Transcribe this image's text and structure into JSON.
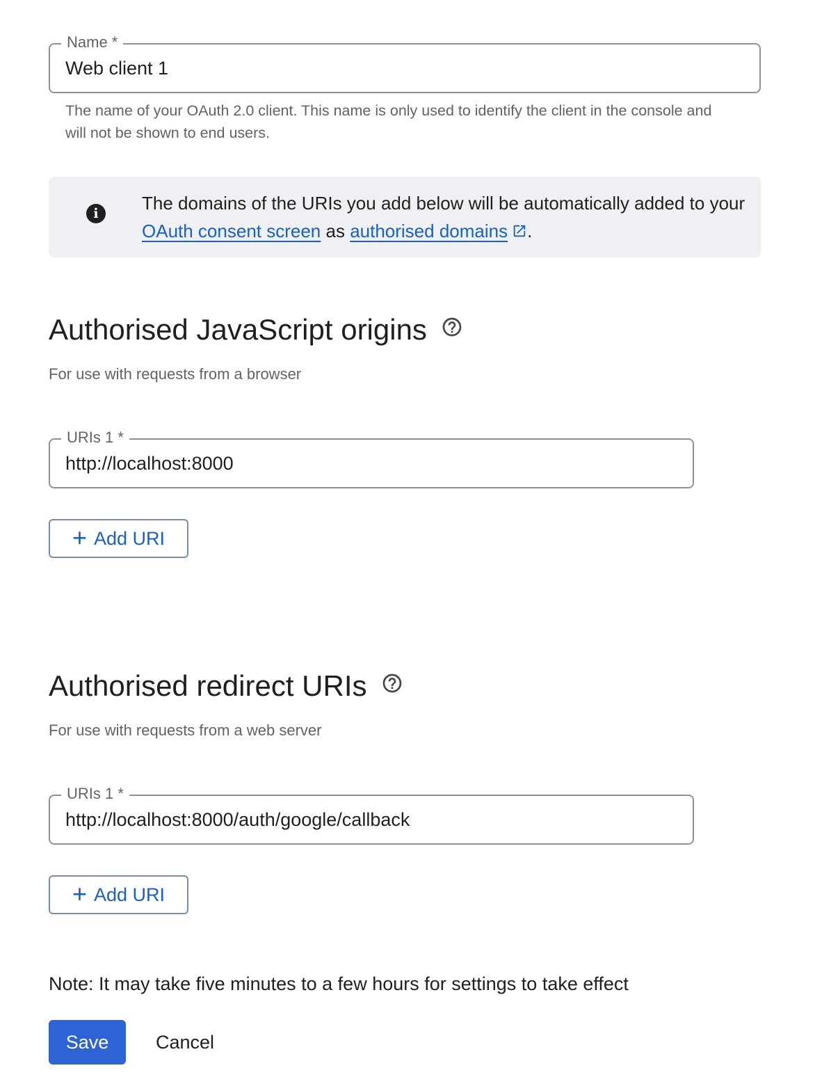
{
  "name_field": {
    "label": "Name *",
    "value": "Web client 1",
    "helper": "The name of your OAuth 2.0 client. This name is only used to identify the client in the console and will not be shown to end users."
  },
  "banner": {
    "icon": "info-icon",
    "text_before": "The domains of the URIs you add below will be automatically added to your ",
    "link1": "OAuth consent screen",
    "text_middle": " as ",
    "link2": "authorised domains",
    "link2_icon": "open-in-new-icon",
    "text_after": "."
  },
  "js_origins": {
    "title": "Authorised JavaScript origins",
    "help_icon": "help-circle-icon",
    "subtitle": "For use with requests from a browser",
    "uri_label": "URIs 1 *",
    "uri_value": "http://localhost:8000",
    "add_label": "Add URI"
  },
  "redirect_uris": {
    "title": "Authorised redirect URIs",
    "help_icon": "help-circle-icon",
    "subtitle": "For use with requests from a web server",
    "uri_label": "URIs 1 *",
    "uri_value": "http://localhost:8000/auth/google/callback",
    "add_label": "Add URI"
  },
  "footer": {
    "note": "Note: It may take five minutes to a few hours for settings to take effect",
    "save_label": "Save",
    "cancel_label": "Cancel"
  },
  "colors": {
    "link": "#1a5fc8",
    "primary_button": "#2e63d6",
    "banner_bg": "#eef0f4",
    "field_border": "#8f9196"
  }
}
